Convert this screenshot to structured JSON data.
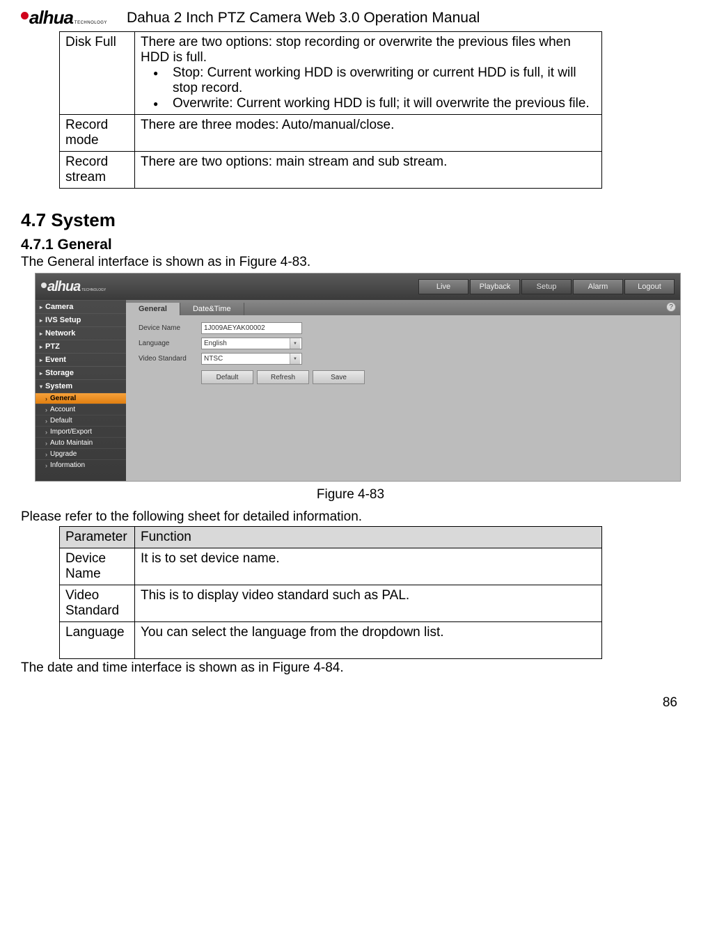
{
  "header": {
    "brand": "alhua",
    "brand_sub": "TECHNOLOGY",
    "doc_title": "Dahua 2 Inch PTZ Camera Web 3.0 Operation Manual"
  },
  "table1": {
    "rows": [
      {
        "param": "Disk Full",
        "desc_intro": "There are two options: stop recording or overwrite the previous files when HDD is full.",
        "bullets": [
          "Stop: Current working HDD is overwriting or current HDD is full, it will stop record.",
          "Overwrite: Current working HDD is full; it will overwrite the previous file."
        ]
      },
      {
        "param": "Record mode",
        "desc_intro": "There are three modes: Auto/manual/close."
      },
      {
        "param": "Record stream",
        "desc_intro": "There are two options: main stream and sub stream."
      }
    ]
  },
  "section": {
    "num_title": "4.7  System",
    "sub_num_title": "4.7.1   General",
    "intro": "The General interface is shown as in Figure 4-83.",
    "fig_caption": "Figure 4-83",
    "detail_intro": "Please refer to the following sheet for detailed information.",
    "outro": "The date and time interface is shown as in Figure 4-84."
  },
  "table2": {
    "head_param": "Parameter",
    "head_func": "Function",
    "rows": [
      {
        "param": "Device Name",
        "func": "It is to set device name."
      },
      {
        "param": "Video Standard",
        "func": "This is to display video standard such as PAL."
      },
      {
        "param": "Language",
        "func": "You can select the language from the dropdown list."
      }
    ]
  },
  "figure": {
    "brand": "alhua",
    "brand_sub": "TECHNOLOGY",
    "nav": [
      "Live",
      "Playback",
      "Setup",
      "Alarm",
      "Logout"
    ],
    "nav_active": "Setup",
    "sidebar_cats": [
      "Camera",
      "IVS Setup",
      "Network",
      "PTZ",
      "Event",
      "Storage",
      "System"
    ],
    "sidebar_open": "System",
    "sidebar_subs": [
      "General",
      "Account",
      "Default",
      "Import/Export",
      "Auto Maintain",
      "Upgrade",
      "Information"
    ],
    "sidebar_sub_active": "General",
    "tabs": [
      "General",
      "Date&Time"
    ],
    "tab_active": "General",
    "help": "?",
    "form": {
      "device_name_label": "Device Name",
      "device_name_value": "1J009AEYAK00002",
      "language_label": "Language",
      "language_value": "English",
      "video_standard_label": "Video Standard",
      "video_standard_value": "NTSC"
    },
    "buttons": [
      "Default",
      "Refresh",
      "Save"
    ]
  },
  "page_number": "86"
}
